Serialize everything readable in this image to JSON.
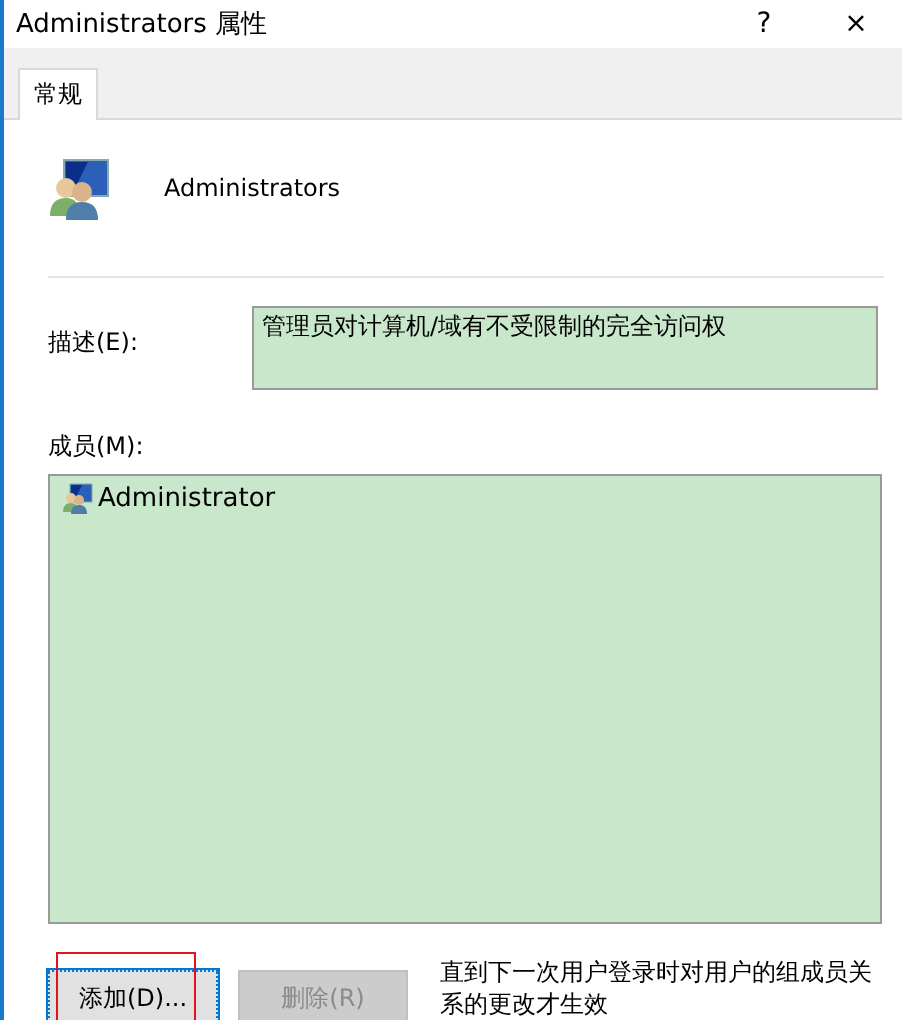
{
  "window": {
    "title": "Administrators 属性",
    "help": "?",
    "close": "×"
  },
  "tabs": [
    {
      "label": "常规",
      "selected": true
    }
  ],
  "group": {
    "name": "Administrators"
  },
  "description": {
    "label": "描述(E):",
    "value": "管理员对计算机/域有不受限制的完全访问权"
  },
  "members": {
    "label": "成员(M):",
    "items": [
      {
        "name": "Administrator",
        "selected": false
      }
    ]
  },
  "buttons": [
    {
      "label": "添加(D)...",
      "disabled": false,
      "highlighted": true
    },
    {
      "label": "删除(R)",
      "disabled": true,
      "highlighted": false
    }
  ],
  "note": "直到下一次用户登录时对用户的组成员关系的更改才生效"
}
